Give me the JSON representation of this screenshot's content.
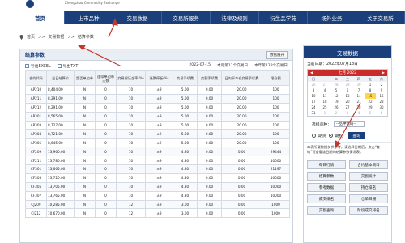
{
  "header": {
    "subtitle": "Zhengzhou Commodity Exchange"
  },
  "nav": [
    "首页",
    "上市品种",
    "交易数据",
    "交易所服务",
    "法律及规则",
    "衍生品学苑",
    "场外业务",
    "关于交易所"
  ],
  "breadcrumb": {
    "home": "首页",
    "sep": ">>",
    "section": "交易数据",
    "page": "结算参数"
  },
  "panel": {
    "title": "结算参数",
    "expand_label": "数据展开",
    "export_excel": "导出EXCEL",
    "export_txt": "导出TXT",
    "date": "2022-07-15",
    "month_count": "本月第11个交易日",
    "year_count": "本年第128个交易日"
  },
  "table": {
    "headers": [
      "合约代码",
      "当日结算价",
      "是否单边市",
      "连续单边市天数",
      "交易保证金率(%)",
      "涨跌停板(%)",
      "交易手续费",
      "交割手续费",
      "日内平今仓交易手续费",
      "限仓额"
    ],
    "rows": [
      [
        "AP210",
        "8,404.00",
        "N",
        "0",
        "10",
        "±9",
        "5.00",
        "0.00",
        "20.00",
        "100"
      ],
      [
        "AP211",
        "8,291.00",
        "N",
        "0",
        "10",
        "±9",
        "5.00",
        "0.00",
        "20.00",
        "100"
      ],
      [
        "AP212",
        "8,291.00",
        "N",
        "0",
        "10",
        "±9",
        "5.00",
        "0.00",
        "20.00",
        "100"
      ],
      [
        "AP301",
        "8,565.00",
        "N",
        "0",
        "10",
        "±9",
        "5.00",
        "0.00",
        "20.00",
        "100"
      ],
      [
        "AP303",
        "8,727.00",
        "N",
        "0",
        "10",
        "±9",
        "5.00",
        "0.00",
        "20.00",
        "100"
      ],
      [
        "AP304",
        "8,721.00",
        "N",
        "0",
        "10",
        "±9",
        "5.00",
        "0.00",
        "20.00",
        "100"
      ],
      [
        "AP305",
        "8,645.00",
        "N",
        "0",
        "10",
        "±9",
        "5.00",
        "0.00",
        "20.00",
        "100"
      ],
      [
        "CF209",
        "13,960.00",
        "N",
        "0",
        "10",
        "±9",
        "4.30",
        "0.00",
        "0.00",
        "29444"
      ],
      [
        "CF211",
        "13,780.00",
        "N",
        "0",
        "10",
        "±9",
        "4.30",
        "0.00",
        "0.00",
        "10000"
      ],
      [
        "CF301",
        "13,665.00",
        "N",
        "0",
        "10",
        "±9",
        "4.30",
        "0.00",
        "0.00",
        "21197"
      ],
      [
        "CF303",
        "13,720.00",
        "N",
        "0",
        "10",
        "±9",
        "4.30",
        "0.00",
        "0.00",
        "10000"
      ],
      [
        "CF305",
        "13,705.00",
        "N",
        "0",
        "10",
        "±9",
        "4.30",
        "0.00",
        "0.00",
        "10000"
      ],
      [
        "CF307",
        "13,765.00",
        "N",
        "0",
        "10",
        "±9",
        "4.30",
        "0.00",
        "0.00",
        "10000"
      ],
      [
        "CJ209",
        "10,285.00",
        "N",
        "0",
        "12",
        "±9",
        "3.00",
        "0.00",
        "0.00",
        "1000"
      ],
      [
        "CJ212",
        "10,670.00",
        "N",
        "0",
        "12",
        "±9",
        "3.00",
        "0.00",
        "0.00",
        "1000"
      ]
    ]
  },
  "sidebar": {
    "title": "交易数据",
    "date_label": "当前日期：2022年07月18日",
    "calendar": {
      "month": "七月 2022",
      "days_of_week": [
        "日",
        "一",
        "二",
        "三",
        "四",
        "五",
        "六"
      ],
      "days": [
        "26",
        "27",
        "28",
        "29",
        "30",
        "1",
        "2",
        "3",
        "4",
        "5",
        "6",
        "7",
        "8",
        "9",
        "10",
        "11",
        "12",
        "13",
        "14",
        "15",
        "16",
        "17",
        "18",
        "19",
        "20",
        "21",
        "22",
        "23",
        "24",
        "25",
        "26",
        "27",
        "28",
        "29",
        "30",
        "31",
        "1",
        "2",
        "3",
        "4",
        "5",
        "6"
      ],
      "selected_day": "15"
    },
    "variety_label": "选择品种：",
    "variety_value": "--品种代码--",
    "option_period": "期货",
    "option_option": "期权",
    "query_label": "查询",
    "note": "本表所载数据仅供参考，请选择日期后，点击“查询”可查看该日期的结算参数情况表。",
    "links": [
      "每日行情",
      "合约基本资料",
      "结算参数",
      "交割统计",
      "参考数据",
      "持仓排名",
      "成交排名",
      "仓单日报",
      "交割查询",
      "阶段成交排名"
    ]
  },
  "colors": {
    "nav_bg": "#1b3f7a",
    "calendar_head": "#c92b2b",
    "selected": "#ffd54a",
    "arrow": "#c0392b"
  }
}
